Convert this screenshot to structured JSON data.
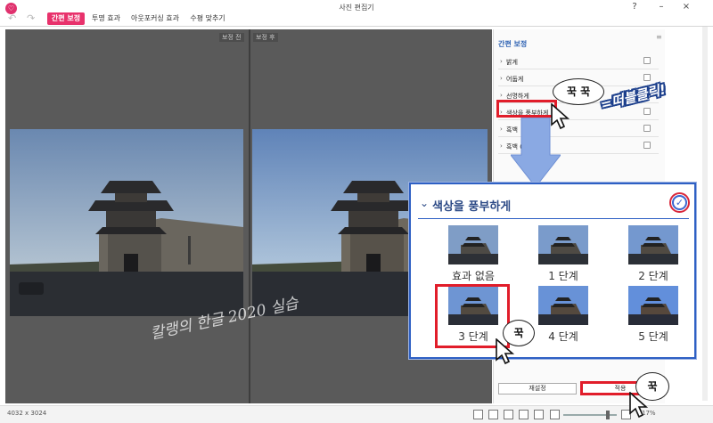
{
  "window": {
    "title": "사진 편집기",
    "help": "?",
    "minimize": "–",
    "maximize": "□",
    "close": "×"
  },
  "toolbar": {
    "undo": "↶",
    "redo": "↷"
  },
  "tabs": [
    {
      "label": "간편 보정",
      "active": true
    },
    {
      "label": "투명 효과",
      "active": false
    },
    {
      "label": "아웃포커싱 효과",
      "active": false
    },
    {
      "label": "수평 맞추기",
      "active": false
    }
  ],
  "canvas": {
    "before_label": "보정 전",
    "after_label": "보정 후",
    "watermark": "칼랭의 한글 2020 실습"
  },
  "status": {
    "image_size": "4032 x 3024",
    "zoom": "17%",
    "zoom_fraction": 0.83
  },
  "panel": {
    "title": "간편 보정",
    "menu_icon": "≡",
    "options": [
      {
        "label": "밝게",
        "checked": false
      },
      {
        "label": "어둡게",
        "checked": false
      },
      {
        "label": "선명하게",
        "checked": false
      },
      {
        "label": "색상을 풍부하게",
        "checked": false
      },
      {
        "label": "흑백",
        "checked": false
      },
      {
        "label": "흑백 (흑갈색)",
        "checked": false
      }
    ],
    "reset_label": "재설정",
    "apply_label": "적용"
  },
  "popup": {
    "title": "색상을 풍부하게",
    "items": [
      "효과 없음",
      "1 단계",
      "2 단계",
      "3 단계",
      "4 단계",
      "5 단계"
    ],
    "selected_index": 3,
    "checked": true
  },
  "annotations": {
    "callout_text": "꾹",
    "callout_text_double": "꾹 꾹",
    "double_click": "=떠블클릭!"
  },
  "colors": {
    "accent": "#e8326c",
    "panel_title": "#2e62b3",
    "popup_border": "#2e60c4",
    "highlight": "#e11d2a"
  }
}
